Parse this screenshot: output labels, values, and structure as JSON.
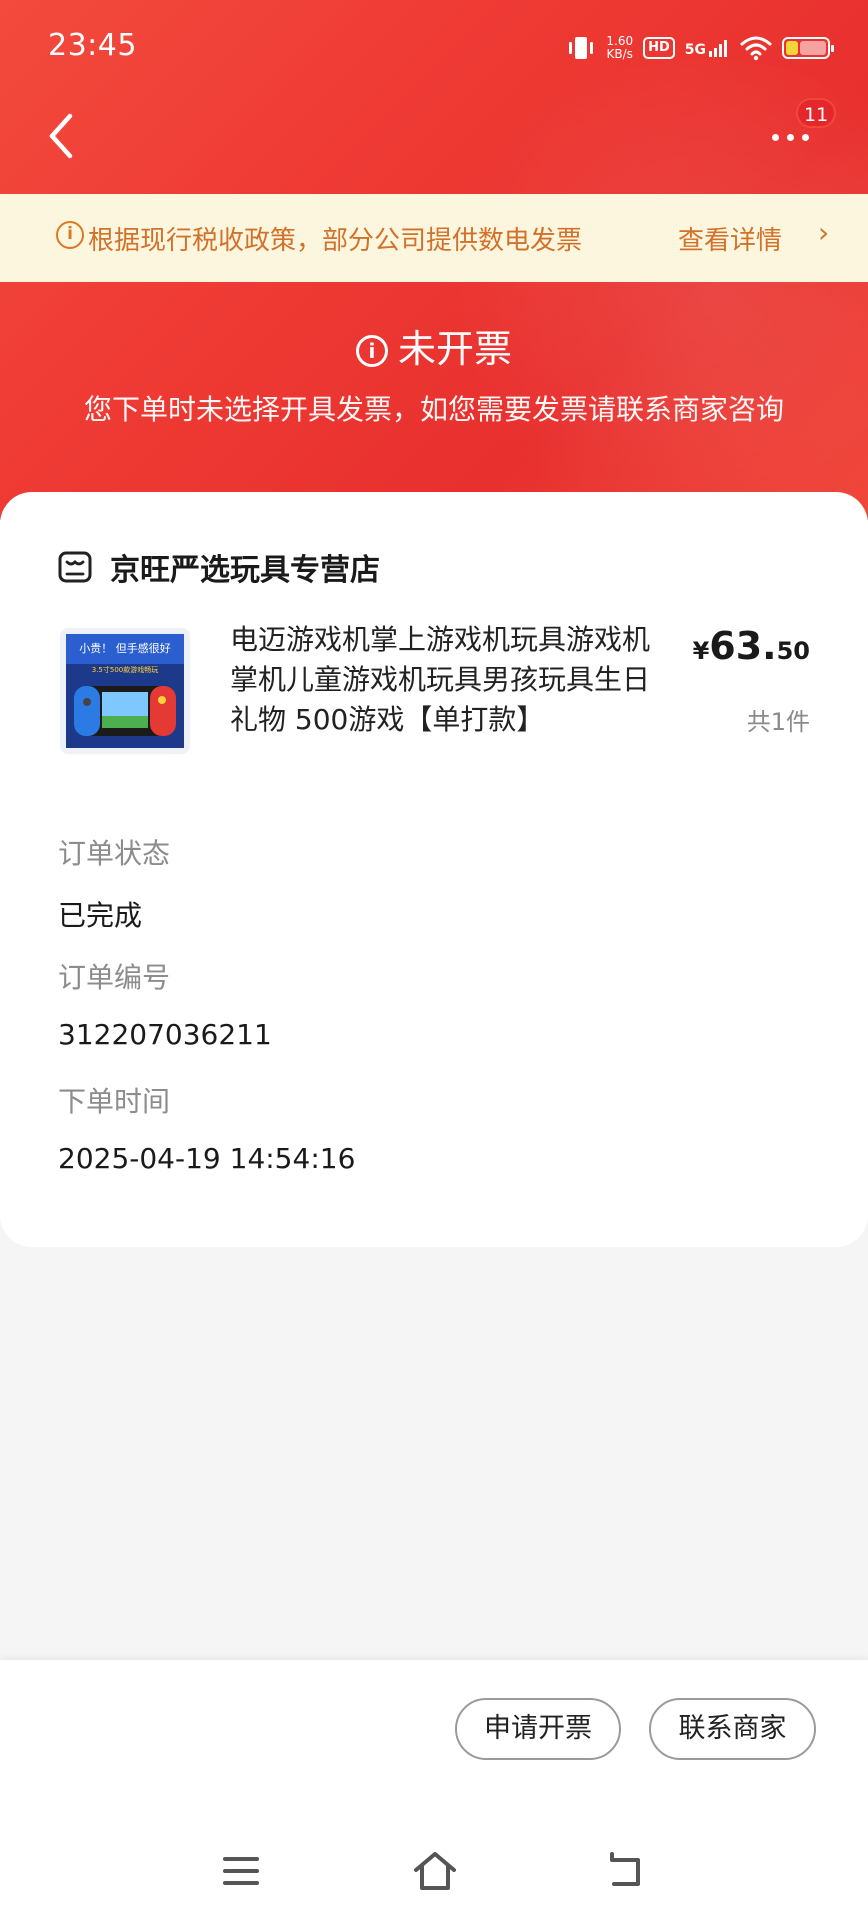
{
  "status_bar": {
    "time": "23:45",
    "speed_value": "1.60",
    "speed_unit": "KB/s",
    "hd_label": "HD",
    "network_label": "5G",
    "icons": [
      "vibrate-icon",
      "hd-icon",
      "signal-icon",
      "wifi-icon",
      "battery-icon"
    ]
  },
  "nav": {
    "back_icon": "chevron-left-icon",
    "more_icon": "more-dots-icon",
    "badge_count": "11"
  },
  "notice": {
    "text": "根据现行税收政策，部分公司提供数电发票",
    "link": "查看详情",
    "arrow": "›"
  },
  "invoice_status": {
    "title": "未开票",
    "description": "您下单时未选择开具发票，如您需要发票请联系商家咨询"
  },
  "shop": {
    "name": "京旺严选玩具专营店",
    "icon": "shop-icon"
  },
  "product": {
    "title": "电迈游戏机掌上游戏机玩具游戏机掌机儿童游戏机玩具男孩玩具生日礼物 500游戏【单打款】",
    "image_text": "小贵！ 但手感很好",
    "image_subtext": "3.5寸500款游戏畅玩",
    "currency": "¥",
    "price_int": "63.",
    "price_dec": "50",
    "quantity": "共1件"
  },
  "order_info": {
    "status_label": "订单状态",
    "status_value": "已完成",
    "number_label": "订单编号",
    "number_value": "312207036211",
    "time_label": "下单时间",
    "time_value": "2025-04-19 14:54:16"
  },
  "actions": {
    "apply_invoice": "申请开票",
    "contact_merchant": "联系商家"
  },
  "system_nav": {
    "icons": [
      "menu-icon",
      "home-icon",
      "back-icon"
    ]
  }
}
